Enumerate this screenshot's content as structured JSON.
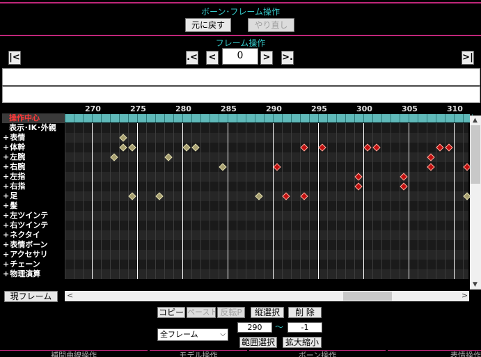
{
  "bone_frame": {
    "title": "ボーン･フレーム操作",
    "undo_label": "元に戻す",
    "redo_label": "やり直し"
  },
  "frame_ops": {
    "title": "フレーム操作",
    "first_label": "|<",
    "prev_key_label": ".<",
    "prev_label": "<",
    "frame_value": "0",
    "next_label": ">",
    "next_key_label": ">.",
    "last_label": ">|"
  },
  "timeline": {
    "frame_numbers": [
      "270",
      "275",
      "280",
      "285",
      "290",
      "295",
      "300",
      "305",
      "310"
    ],
    "rows": [
      {
        "label": "操作中心",
        "style": "red",
        "plus": false
      },
      {
        "label": "表示･IK･外親",
        "style": "normal",
        "plus": false
      },
      {
        "label": "表情",
        "style": "normal",
        "plus": true
      },
      {
        "label": "体幹",
        "style": "normal",
        "plus": true
      },
      {
        "label": "左腕",
        "style": "normal",
        "plus": true
      },
      {
        "label": "右腕",
        "style": "normal",
        "plus": true
      },
      {
        "label": "左指",
        "style": "normal",
        "plus": true
      },
      {
        "label": "右指",
        "style": "normal",
        "plus": true
      },
      {
        "label": "足",
        "style": "normal",
        "plus": true
      },
      {
        "label": "髪",
        "style": "normal",
        "plus": true
      },
      {
        "label": "左ツインテ",
        "style": "normal",
        "plus": true
      },
      {
        "label": "右ツインテ",
        "style": "normal",
        "plus": true
      },
      {
        "label": "ネクタイ",
        "style": "normal",
        "plus": true
      },
      {
        "label": "表情ボーン",
        "style": "normal",
        "plus": true
      },
      {
        "label": "アクセサリ",
        "style": "normal",
        "plus": true
      },
      {
        "label": "チェーン",
        "style": "normal",
        "plus": true
      },
      {
        "label": "物理演算",
        "style": "normal",
        "plus": true
      }
    ],
    "keyframes": [
      {
        "row": 2,
        "frame": 273,
        "color": "olive"
      },
      {
        "row": 3,
        "frame": 273,
        "color": "olive"
      },
      {
        "row": 3,
        "frame": 274,
        "color": "olive"
      },
      {
        "row": 3,
        "frame": 280,
        "color": "olive"
      },
      {
        "row": 3,
        "frame": 281,
        "color": "olive"
      },
      {
        "row": 3,
        "frame": 293,
        "color": "red"
      },
      {
        "row": 3,
        "frame": 295,
        "color": "red"
      },
      {
        "row": 3,
        "frame": 300,
        "color": "red"
      },
      {
        "row": 3,
        "frame": 301,
        "color": "red"
      },
      {
        "row": 3,
        "frame": 308,
        "color": "red"
      },
      {
        "row": 3,
        "frame": 309,
        "color": "red"
      },
      {
        "row": 4,
        "frame": 272,
        "color": "olive"
      },
      {
        "row": 4,
        "frame": 278,
        "color": "olive"
      },
      {
        "row": 4,
        "frame": 307,
        "color": "red"
      },
      {
        "row": 5,
        "frame": 284,
        "color": "olive"
      },
      {
        "row": 5,
        "frame": 290,
        "color": "red"
      },
      {
        "row": 5,
        "frame": 307,
        "color": "red"
      },
      {
        "row": 5,
        "frame": 311,
        "color": "red"
      },
      {
        "row": 6,
        "frame": 299,
        "color": "red"
      },
      {
        "row": 6,
        "frame": 304,
        "color": "red"
      },
      {
        "row": 7,
        "frame": 299,
        "color": "red"
      },
      {
        "row": 7,
        "frame": 304,
        "color": "red"
      },
      {
        "row": 8,
        "frame": 274,
        "color": "olive"
      },
      {
        "row": 8,
        "frame": 277,
        "color": "olive"
      },
      {
        "row": 8,
        "frame": 288,
        "color": "olive"
      },
      {
        "row": 8,
        "frame": 291,
        "color": "red"
      },
      {
        "row": 8,
        "frame": 293,
        "color": "red"
      },
      {
        "row": 8,
        "frame": 311,
        "color": "olive"
      }
    ]
  },
  "current_frame_label": "現フレーム",
  "edit": {
    "copy_label": "コピー",
    "paste_label": "ペースト",
    "reverse_label": "反転P",
    "vertical_select_label": "縦選択",
    "delete_label": "削 除",
    "range_start": "290",
    "range_tilde": "～",
    "range_end": "-1",
    "frame_select_value": "全フレーム",
    "range_select_label": "範囲選択",
    "scale_label": "拡大縮小"
  },
  "bottom_tabs": [
    "補間曲線操作",
    "モデル操作",
    "ボーン操作",
    "表情操作"
  ],
  "colors": {
    "accent_pink": "#c0267a",
    "teal_title": "#35c9c9",
    "keyframe_red": "#c01010",
    "keyframe_olive": "#a8a070",
    "ruler_teal": "#5fb9b9"
  }
}
